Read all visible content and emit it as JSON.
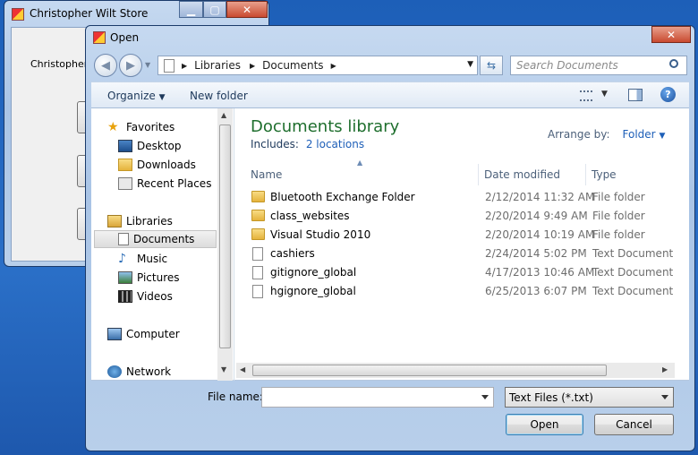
{
  "background_window": {
    "title": "Christopher Wilt Store",
    "label": "Christopher W"
  },
  "dialog": {
    "title": "Open",
    "close_glyph": "✕",
    "address": {
      "crumbs": [
        "Libraries",
        "Documents"
      ],
      "search_placeholder": "Search Documents"
    },
    "toolbar": {
      "organize_label": "Organize",
      "new_folder_label": "New folder"
    },
    "nav": {
      "favorites": "Favorites",
      "desktop": "Desktop",
      "downloads": "Downloads",
      "recent_places": "Recent Places",
      "libraries": "Libraries",
      "documents": "Documents",
      "music": "Music",
      "pictures": "Pictures",
      "videos": "Videos",
      "computer": "Computer",
      "network": "Network"
    },
    "library": {
      "title": "Documents library",
      "includes_label": "Includes:",
      "locations_link": "2 locations",
      "arrange_by_label": "Arrange by:",
      "arrange_by_value": "Folder"
    },
    "columns": {
      "name": "Name",
      "date_modified": "Date modified",
      "type": "Type"
    },
    "files": [
      {
        "name": "Bluetooth Exchange Folder",
        "date": "2/12/2014 11:32 AM",
        "type": "File folder",
        "kind": "folder"
      },
      {
        "name": "class_websites",
        "date": "2/20/2014 9:49 AM",
        "type": "File folder",
        "kind": "folder"
      },
      {
        "name": "Visual Studio 2010",
        "date": "2/20/2014 10:19 AM",
        "type": "File folder",
        "kind": "folder"
      },
      {
        "name": "cashiers",
        "date": "2/24/2014 5:02 PM",
        "type": "Text Document",
        "kind": "file"
      },
      {
        "name": "gitignore_global",
        "date": "4/17/2013 10:46 AM",
        "type": "Text Document",
        "kind": "file"
      },
      {
        "name": "hgignore_global",
        "date": "6/25/2013 6:07 PM",
        "type": "Text Document",
        "kind": "file"
      }
    ],
    "footer": {
      "file_name_label": "File name:",
      "file_name_value": "",
      "filter_value": "Text Files (*.txt)",
      "open_label": "Open",
      "cancel_label": "Cancel"
    }
  },
  "colors": {
    "desktop": "#1d5fb8",
    "library_title": "#1e6e2d",
    "link": "#1e5fb8",
    "close_button": "#c94a30"
  },
  "icons": [
    "app-icon",
    "back-icon",
    "forward-icon",
    "refresh-icon",
    "search-icon",
    "views-icon",
    "preview-pane-icon",
    "help-icon",
    "star-icon",
    "folder-icon",
    "file-icon",
    "computer-icon",
    "network-icon"
  ]
}
